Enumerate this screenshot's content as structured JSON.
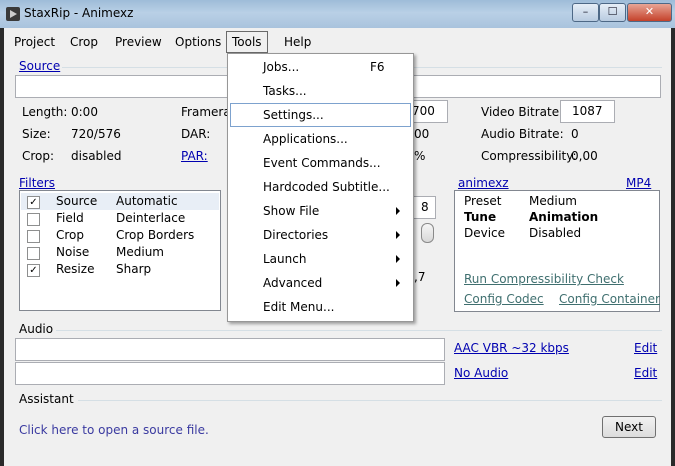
{
  "window": {
    "title": "StaxRip - Animexz",
    "minimize": "–",
    "maximize": "☐",
    "close": "✕"
  },
  "menubar": [
    "Project",
    "Crop",
    "Preview",
    "Options",
    "Tools",
    "Help"
  ],
  "source": {
    "label": "Source"
  },
  "info": {
    "length_label": "Length:",
    "length_value": "0:00",
    "size_label": "Size:",
    "size_value": "720/576",
    "crop_label": "Crop:",
    "crop_value": "disabled",
    "framerate_label": "Framerat",
    "dar_label": "DAR:",
    "par_label": "PAR:",
    "partial_1": "700",
    "partial_2": "00",
    "partial_3": "%",
    "video_bitrate_label": "Video Bitrate:",
    "video_bitrate_value": "1087",
    "audio_bitrate_label": "Audio Bitrate:",
    "audio_bitrate_value": "0",
    "compressibility_label": "Compressibility:",
    "compressibility_value": "0,00"
  },
  "filters": {
    "label": "Filters",
    "rows": [
      {
        "checked": true,
        "name": "Source",
        "value": "Automatic"
      },
      {
        "checked": false,
        "name": "Field",
        "value": "Deinterlace"
      },
      {
        "checked": false,
        "name": "Crop",
        "value": "Crop Borders"
      },
      {
        "checked": false,
        "name": "Noise",
        "value": "Medium"
      },
      {
        "checked": true,
        "name": "Resize",
        "value": "Sharp"
      }
    ]
  },
  "middle": {
    "partial_8": "8",
    "partial_7": ",7"
  },
  "encoder": {
    "profile_link": "animexz",
    "format_link": "MP4",
    "rows": [
      {
        "key": "Preset",
        "value": "Medium"
      },
      {
        "key": "Tune",
        "value": "Animation"
      },
      {
        "key": "Device",
        "value": "Disabled"
      }
    ],
    "compress_link": "Run Compressibility Check",
    "config_codec": "Config Codec",
    "config_container": "Config Container"
  },
  "audio": {
    "label": "Audio",
    "track1_link": "AAC VBR ~32 kbps",
    "track1_edit": "Edit",
    "track2_link": "No Audio",
    "track2_edit": "Edit"
  },
  "assistant": {
    "label": "Assistant",
    "hint": "Click here to open a source file.",
    "next": "Next"
  },
  "tools_menu": [
    {
      "label": "Jobs...",
      "shortcut": "F6",
      "submenu": false
    },
    {
      "label": "Tasks...",
      "shortcut": "",
      "submenu": false
    },
    {
      "label": "Settings...",
      "shortcut": "",
      "submenu": false
    },
    {
      "label": "Applications...",
      "shortcut": "",
      "submenu": false
    },
    {
      "label": "Event Commands...",
      "shortcut": "",
      "submenu": false
    },
    {
      "label": "Hardcoded Subtitle...",
      "shortcut": "",
      "submenu": false
    },
    {
      "label": "Show File",
      "shortcut": "",
      "submenu": true
    },
    {
      "label": "Directories",
      "shortcut": "",
      "submenu": true
    },
    {
      "label": "Launch",
      "shortcut": "",
      "submenu": true
    },
    {
      "label": "Advanced",
      "shortcut": "",
      "submenu": true
    },
    {
      "label": "Edit Menu...",
      "shortcut": "",
      "submenu": false
    }
  ]
}
